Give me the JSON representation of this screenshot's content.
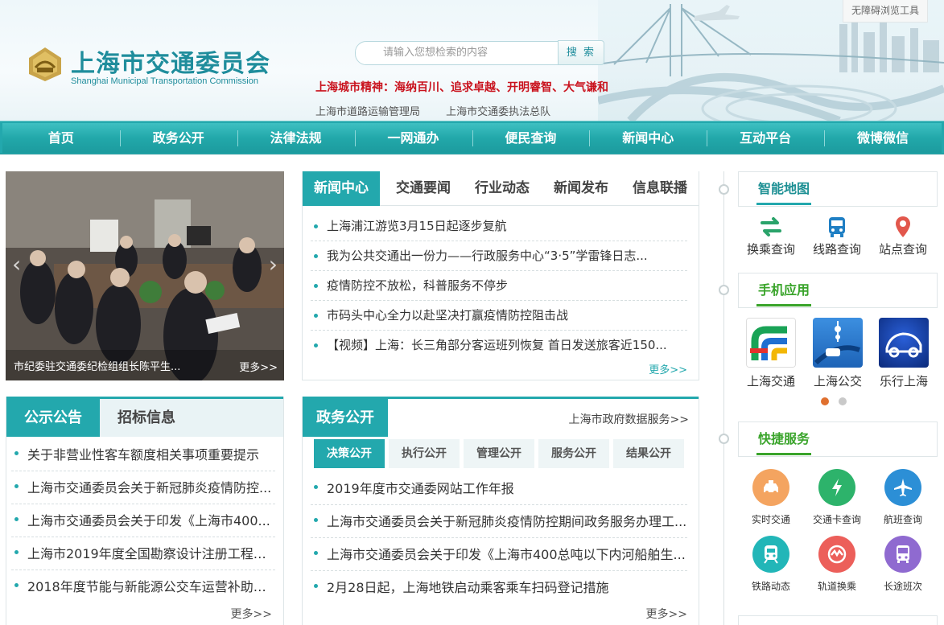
{
  "header": {
    "accessibility_label": "无障碍浏览工具",
    "logo_cn": "上海市交通委员会",
    "logo_en": "Shanghai Municipal Transportation Commission",
    "search_placeholder": "请输入您想检索的内容",
    "search_button": "搜 索",
    "city_spirit": "上海城市精神：海纳百川、追求卓越、开明睿智、大气谦和",
    "sublinks": [
      "上海市道路运输管理局",
      "上海市交通委执法总队"
    ]
  },
  "nav": {
    "items": [
      "首页",
      "政务公开",
      "法律法规",
      "一网通办",
      "便民查询",
      "新闻中心",
      "互动平台",
      "微博微信"
    ]
  },
  "photo": {
    "caption": "市纪委驻交通委纪检组组长陈平生...",
    "more": "更多>>",
    "prev_icon": "chevron-left",
    "next_icon": "chevron-right"
  },
  "news": {
    "tabs": [
      "新闻中心",
      "交通要闻",
      "行业动态",
      "新闻发布",
      "信息联播"
    ],
    "items": [
      "上海浦江游览3月15日起逐步复航",
      "我为公共交通出一份力——行政服务中心“3·5”学雷锋日志...",
      "疫情防控不放松，科普服务不停步",
      "市码头中心全力以赴坚决打赢疫情防控阻击战",
      "【视频】上海：长三角部分客运班列恢复 首日发送旅客近150..."
    ],
    "more": "更多>>"
  },
  "notice": {
    "tabs": [
      "公示公告",
      "招标信息"
    ],
    "items": [
      "关于非营业性客车额度相关事项重要提示",
      "上海市交通委员会关于新冠肺炎疫情防控...",
      "上海市交通委员会关于印发《上海市400...",
      "上海市2019年度全国勘察设计注册工程师...",
      "2018年度节能与新能源公交车运营补助资..."
    ],
    "more": "更多>>"
  },
  "gov": {
    "title": "政务公开",
    "data_link": "上海市政府数据服务>>",
    "subtabs": [
      "决策公开",
      "执行公开",
      "管理公开",
      "服务公开",
      "结果公开"
    ],
    "items": [
      "2019年度市交通委网站工作年报",
      "上海市交通委员会关于新冠肺炎疫情防控期间政务服务办理工...",
      "上海市交通委员会关于印发《上海市400总吨以下内河船舶生...",
      "2月28日起，上海地铁启动乘客乘车扫码登记措施"
    ],
    "more": "更多>>"
  },
  "sidebar": {
    "smart_map": {
      "title": "智能地图",
      "items": [
        {
          "label": "换乘查询",
          "icon": "transfer-icon",
          "color": "#2aa36a"
        },
        {
          "label": "线路查询",
          "icon": "bus-icon",
          "color": "#1f7fc4"
        },
        {
          "label": "站点查询",
          "icon": "location-pin-icon",
          "color": "#e2574c"
        }
      ]
    },
    "mobile_apps": {
      "title": "手机应用",
      "items": [
        "上海交通",
        "上海公交",
        "乐行上海"
      ]
    },
    "quick_services": {
      "title": "快捷服务",
      "items": [
        {
          "label": "实时交通",
          "icon": "taxi-icon",
          "color": "#f4a460"
        },
        {
          "label": "交通卡查询",
          "icon": "lightning-icon",
          "color": "#2db36b"
        },
        {
          "label": "航班查询",
          "icon": "airplane-icon",
          "color": "#2c8fd6"
        },
        {
          "label": "铁路动态",
          "icon": "train-icon",
          "color": "#22b6b8"
        },
        {
          "label": "轨道换乘",
          "icon": "metro-icon",
          "color": "#ec5f5a"
        },
        {
          "label": "长途班次",
          "icon": "coach-icon",
          "color": "#8f6ad0"
        }
      ]
    }
  },
  "colors": {
    "primary": "#23a8ad",
    "spirit_red": "#c9121d",
    "pager_active": "#e0702f"
  }
}
